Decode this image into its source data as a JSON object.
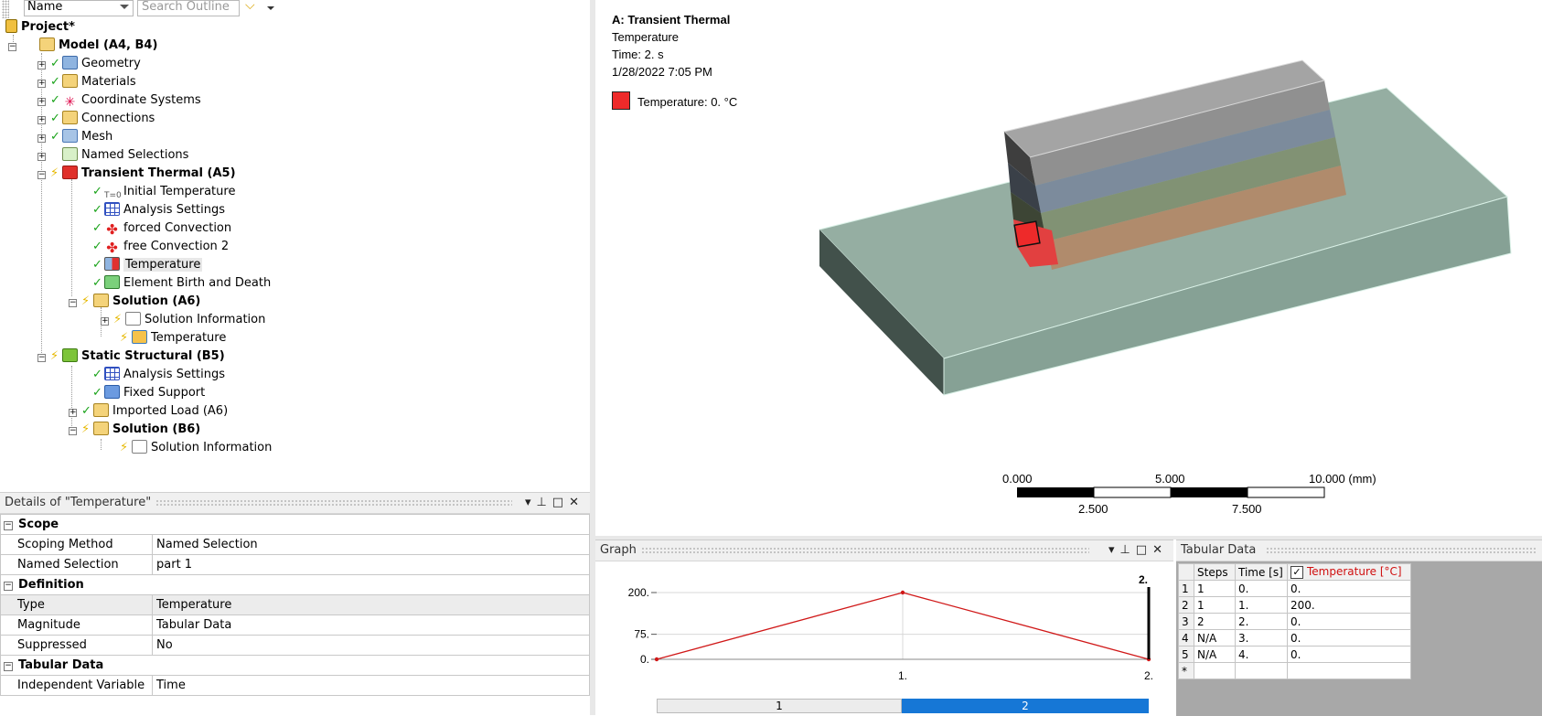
{
  "outline": {
    "filter_combo": "Name",
    "search_placeholder": "Search Outline",
    "tree": [
      {
        "label": "Project*",
        "bold": true
      },
      {
        "label": "Model (A4, B4)",
        "bold": true
      },
      {
        "label": "Geometry"
      },
      {
        "label": "Materials"
      },
      {
        "label": "Coordinate Systems"
      },
      {
        "label": "Connections"
      },
      {
        "label": "Mesh"
      },
      {
        "label": "Named Selections"
      },
      {
        "label": "Transient Thermal (A5)",
        "bold": true
      },
      {
        "label": "Initial Temperature",
        "icon_text": "T=0"
      },
      {
        "label": "Analysis Settings"
      },
      {
        "label": "forced Convection"
      },
      {
        "label": "free Convection 2"
      },
      {
        "label": "Temperature",
        "selected": true
      },
      {
        "label": "Element Birth and Death"
      },
      {
        "label": "Solution (A6)",
        "bold": true
      },
      {
        "label": "Solution Information"
      },
      {
        "label": "Temperature"
      },
      {
        "label": "Static Structural (B5)",
        "bold": true
      },
      {
        "label": "Analysis Settings"
      },
      {
        "label": "Fixed Support"
      },
      {
        "label": "Imported Load (A6)"
      },
      {
        "label": "Solution (B6)",
        "bold": true
      },
      {
        "label": "Solution Information"
      }
    ]
  },
  "details": {
    "title": "Details of \"Temperature\"",
    "groups": [
      {
        "name": "Scope",
        "rows": [
          [
            "Scoping Method",
            "Named Selection"
          ],
          [
            "Named Selection",
            "part 1"
          ]
        ]
      },
      {
        "name": "Definition",
        "rows": [
          [
            "Type",
            "Temperature"
          ],
          [
            "Magnitude",
            "Tabular Data"
          ],
          [
            "Suppressed",
            "No"
          ]
        ]
      },
      {
        "name": "Tabular Data",
        "rows": [
          [
            "Independent Variable",
            "Time"
          ]
        ]
      }
    ]
  },
  "viewport": {
    "info_title": "A: Transient Thermal",
    "info_lines": [
      "Temperature",
      "Time: 2. s",
      "1/28/2022 7:05 PM"
    ],
    "legend_label": "Temperature: 0. °C",
    "legend_color": "#ee2a2a",
    "scale_top": [
      "0.000",
      "5.000",
      "10.000 (mm)"
    ],
    "scale_bottom": [
      "2.500",
      "7.500"
    ]
  },
  "graph": {
    "title": "Graph",
    "marker_label": "2.",
    "steps": [
      "1",
      "2"
    ],
    "chart_data": {
      "type": "line",
      "x": [
        0,
        1,
        2
      ],
      "y": [
        0,
        200,
        0
      ],
      "yticks": [
        "200.",
        "75.",
        "0."
      ],
      "ytick_values": [
        200,
        75,
        0
      ],
      "xticks": [
        "1.",
        "2."
      ],
      "xtick_values": [
        1,
        2
      ],
      "xlim": [
        0,
        2
      ],
      "ylim": [
        0,
        200
      ]
    }
  },
  "tabular": {
    "title": "Tabular Data",
    "headers": [
      "Steps",
      "Time [s]",
      "Temperature [°C]"
    ],
    "rows": [
      [
        "1",
        "1",
        "0.",
        "0."
      ],
      [
        "2",
        "1",
        "1.",
        "200."
      ],
      [
        "3",
        "2",
        "2.",
        "0."
      ],
      [
        "4",
        "N/A",
        "3.",
        "0."
      ],
      [
        "5",
        "N/A",
        "4.",
        "0."
      ]
    ],
    "new_row_marker": "*"
  }
}
